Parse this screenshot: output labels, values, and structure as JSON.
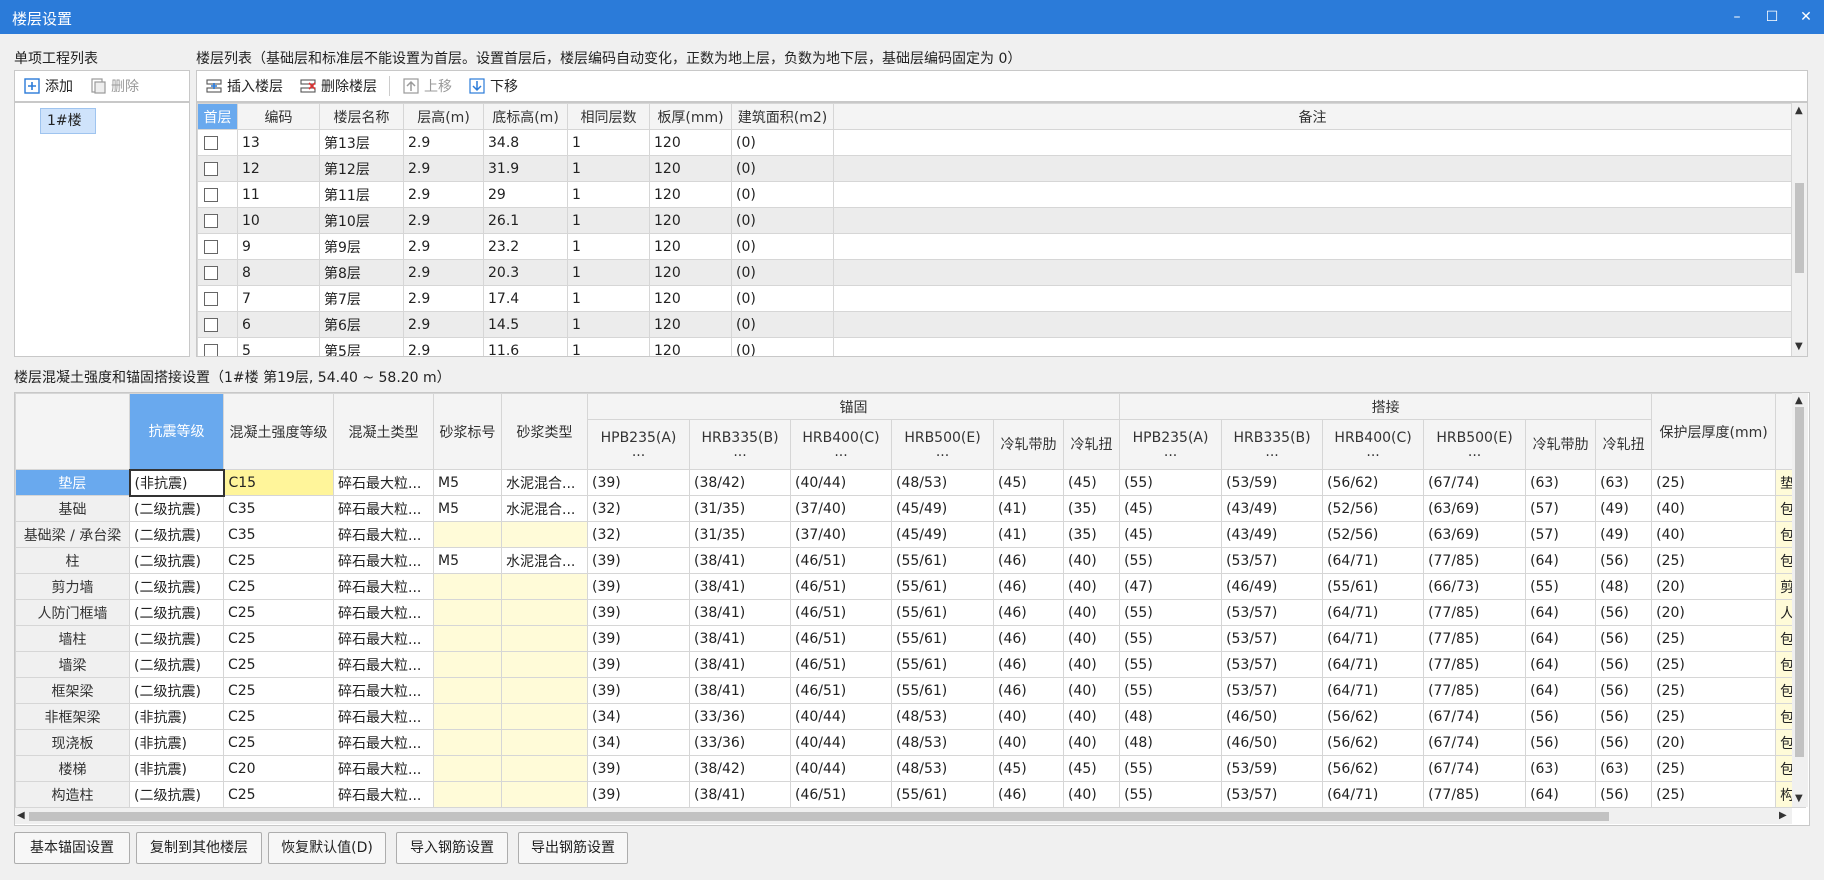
{
  "window": {
    "title": "楼层设置",
    "minimize": "–",
    "maximize": "☐",
    "close": "✕"
  },
  "project_panel": {
    "label": "单项工程列表",
    "add_label": "添加",
    "delete_label": "删除",
    "items": [
      "1#楼"
    ]
  },
  "floor_panel": {
    "label": "楼层列表（基础层和标准层不能设置为首层。设置首层后，楼层编码自动变化，正数为地上层，负数为地下层，基础层编码固定为 0）",
    "toolbar": {
      "insert": "插入楼层",
      "delete": "删除楼层",
      "up": "上移",
      "down": "下移"
    },
    "columns": [
      "首层",
      "编码",
      "楼层名称",
      "层高(m)",
      "底标高(m)",
      "相同层数",
      "板厚(mm)",
      "建筑面积(m2)",
      "备注"
    ],
    "rows": [
      [
        "13",
        "第13层",
        "2.9",
        "34.8",
        "1",
        "120",
        "(0)",
        ""
      ],
      [
        "12",
        "第12层",
        "2.9",
        "31.9",
        "1",
        "120",
        "(0)",
        ""
      ],
      [
        "11",
        "第11层",
        "2.9",
        "29",
        "1",
        "120",
        "(0)",
        ""
      ],
      [
        "10",
        "第10层",
        "2.9",
        "26.1",
        "1",
        "120",
        "(0)",
        ""
      ],
      [
        "9",
        "第9层",
        "2.9",
        "23.2",
        "1",
        "120",
        "(0)",
        ""
      ],
      [
        "8",
        "第8层",
        "2.9",
        "20.3",
        "1",
        "120",
        "(0)",
        ""
      ],
      [
        "7",
        "第7层",
        "2.9",
        "17.4",
        "1",
        "120",
        "(0)",
        ""
      ],
      [
        "6",
        "第6层",
        "2.9",
        "14.5",
        "1",
        "120",
        "(0)",
        ""
      ],
      [
        "5",
        "第5层",
        "2.9",
        "11.6",
        "1",
        "120",
        "(0)",
        ""
      ]
    ]
  },
  "anchor_panel": {
    "label": "楼层混凝土强度和锚固搭接设置（1#楼  第19层, 54.40 ~ 58.20 m）",
    "group_anchor": "锚固",
    "group_lap": "搭接",
    "head_cols": [
      "抗震等级",
      "混凝土强度等级",
      "混凝土类型",
      "砂浆标号",
      "砂浆类型"
    ],
    "steel_cols": [
      [
        "HPB235(A)",
        "..."
      ],
      [
        "HRB335(B)",
        "..."
      ],
      [
        "HRB400(C)",
        "..."
      ],
      [
        "HRB500(E)",
        "..."
      ],
      [
        "冷轧带肋",
        ""
      ],
      [
        "冷轧扭",
        ""
      ]
    ],
    "tail_cols": [
      "保护层厚度(mm)",
      ""
    ],
    "rows": [
      {
        "name": "垫层",
        "cells": [
          "(非抗震)",
          "C15",
          "碎石最大粒...",
          "M5",
          "水泥混合...",
          "(39)",
          "(38/42)",
          "(40/44)",
          "(48/53)",
          "(45)",
          "(45)",
          "(55)",
          "(53/59)",
          "(56/62)",
          "(67/74)",
          "(63)",
          "(63)",
          "(25)",
          "垫"
        ]
      },
      {
        "name": "基础",
        "cells": [
          "(二级抗震)",
          "C35",
          "碎石最大粒...",
          "M5",
          "水泥混合...",
          "(32)",
          "(31/35)",
          "(37/40)",
          "(45/49)",
          "(41)",
          "(35)",
          "(45)",
          "(43/49)",
          "(52/56)",
          "(63/69)",
          "(57)",
          "(49)",
          "(40)",
          "包"
        ]
      },
      {
        "name": "基础梁 / 承台梁",
        "cells": [
          "(二级抗震)",
          "C35",
          "碎石最大粒...",
          "",
          "",
          "(32)",
          "(31/35)",
          "(37/40)",
          "(45/49)",
          "(41)",
          "(35)",
          "(45)",
          "(43/49)",
          "(52/56)",
          "(63/69)",
          "(57)",
          "(49)",
          "(40)",
          "包"
        ]
      },
      {
        "name": "柱",
        "cells": [
          "(二级抗震)",
          "C25",
          "碎石最大粒...",
          "M5",
          "水泥混合...",
          "(39)",
          "(38/41)",
          "(46/51)",
          "(55/61)",
          "(46)",
          "(40)",
          "(55)",
          "(53/57)",
          "(64/71)",
          "(77/85)",
          "(64)",
          "(56)",
          "(25)",
          "包"
        ]
      },
      {
        "name": "剪力墙",
        "cells": [
          "(二级抗震)",
          "C25",
          "碎石最大粒...",
          "",
          "",
          "(39)",
          "(38/41)",
          "(46/51)",
          "(55/61)",
          "(46)",
          "(40)",
          "(47)",
          "(46/49)",
          "(55/61)",
          "(66/73)",
          "(55)",
          "(48)",
          "(20)",
          "剪"
        ]
      },
      {
        "name": "人防门框墙",
        "cells": [
          "(二级抗震)",
          "C25",
          "碎石最大粒...",
          "",
          "",
          "(39)",
          "(38/41)",
          "(46/51)",
          "(55/61)",
          "(46)",
          "(40)",
          "(55)",
          "(53/57)",
          "(64/71)",
          "(77/85)",
          "(64)",
          "(56)",
          "(20)",
          "人"
        ]
      },
      {
        "name": "墙柱",
        "cells": [
          "(二级抗震)",
          "C25",
          "碎石最大粒...",
          "",
          "",
          "(39)",
          "(38/41)",
          "(46/51)",
          "(55/61)",
          "(46)",
          "(40)",
          "(55)",
          "(53/57)",
          "(64/71)",
          "(77/85)",
          "(64)",
          "(56)",
          "(25)",
          "包"
        ]
      },
      {
        "name": "墙梁",
        "cells": [
          "(二级抗震)",
          "C25",
          "碎石最大粒...",
          "",
          "",
          "(39)",
          "(38/41)",
          "(46/51)",
          "(55/61)",
          "(46)",
          "(40)",
          "(55)",
          "(53/57)",
          "(64/71)",
          "(77/85)",
          "(64)",
          "(56)",
          "(25)",
          "包"
        ]
      },
      {
        "name": "框架梁",
        "cells": [
          "(二级抗震)",
          "C25",
          "碎石最大粒...",
          "",
          "",
          "(39)",
          "(38/41)",
          "(46/51)",
          "(55/61)",
          "(46)",
          "(40)",
          "(55)",
          "(53/57)",
          "(64/71)",
          "(77/85)",
          "(64)",
          "(56)",
          "(25)",
          "包"
        ]
      },
      {
        "name": "非框架梁",
        "cells": [
          "(非抗震)",
          "C25",
          "碎石最大粒...",
          "",
          "",
          "(34)",
          "(33/36)",
          "(40/44)",
          "(48/53)",
          "(40)",
          "(40)",
          "(48)",
          "(46/50)",
          "(56/62)",
          "(67/74)",
          "(56)",
          "(56)",
          "(25)",
          "包"
        ]
      },
      {
        "name": "现浇板",
        "cells": [
          "(非抗震)",
          "C25",
          "碎石最大粒...",
          "",
          "",
          "(34)",
          "(33/36)",
          "(40/44)",
          "(48/53)",
          "(40)",
          "(40)",
          "(48)",
          "(46/50)",
          "(56/62)",
          "(67/74)",
          "(56)",
          "(56)",
          "(20)",
          "包"
        ]
      },
      {
        "name": "楼梯",
        "cells": [
          "(非抗震)",
          "C20",
          "碎石最大粒...",
          "",
          "",
          "(39)",
          "(38/42)",
          "(40/44)",
          "(48/53)",
          "(45)",
          "(45)",
          "(55)",
          "(53/59)",
          "(56/62)",
          "(67/74)",
          "(63)",
          "(63)",
          "(25)",
          "包"
        ]
      },
      {
        "name": "构造柱",
        "cells": [
          "(二级抗震)",
          "C25",
          "碎石最大粒...",
          "",
          "",
          "(39)",
          "(38/41)",
          "(46/51)",
          "(55/61)",
          "(46)",
          "(40)",
          "(55)",
          "(53/57)",
          "(64/71)",
          "(77/85)",
          "(64)",
          "(56)",
          "(25)",
          "构"
        ]
      }
    ]
  },
  "bottom_buttons": [
    "基本锚固设置",
    "复制到其他楼层",
    "恢复默认值(D)",
    "导入钢筋设置",
    "导出钢筋设置"
  ]
}
